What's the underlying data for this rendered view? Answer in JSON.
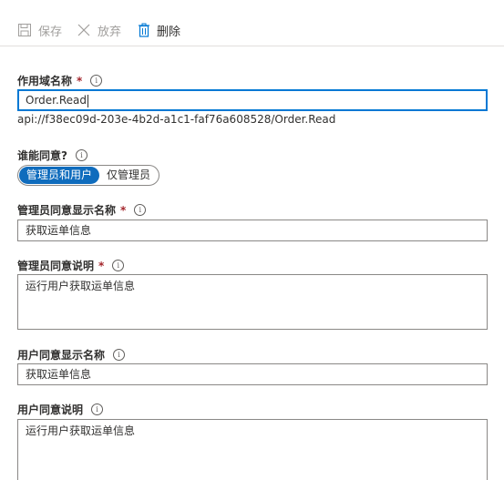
{
  "toolbar": {
    "save_label": "保存",
    "discard_label": "放弃",
    "delete_label": "删除"
  },
  "scope_name": {
    "label": "作用域名称",
    "required_mark": "*",
    "value": "Order.Read",
    "full_uri": "api://f38ec09d-203e-4b2d-a1c1-faf76a608528/Order.Read"
  },
  "consent": {
    "label": "谁能同意?",
    "options": [
      "管理员和用户",
      "仅管理员"
    ],
    "selected": "管理员和用户"
  },
  "admin_display_name": {
    "label": "管理员同意显示名称",
    "required_mark": "*",
    "value": "获取运单信息"
  },
  "admin_description": {
    "label": "管理员同意说明",
    "required_mark": "*",
    "value": "运行用户获取运单信息"
  },
  "user_display_name": {
    "label": "用户同意显示名称",
    "value": "获取运单信息"
  },
  "user_description": {
    "label": "用户同意说明",
    "value": "运行用户获取运单信息"
  },
  "colors": {
    "accent": "#0078d4",
    "toggle_active": "#0f6cbd",
    "required": "#a4262c",
    "disabled_text": "#a19f9d"
  },
  "info_glyph": "i"
}
